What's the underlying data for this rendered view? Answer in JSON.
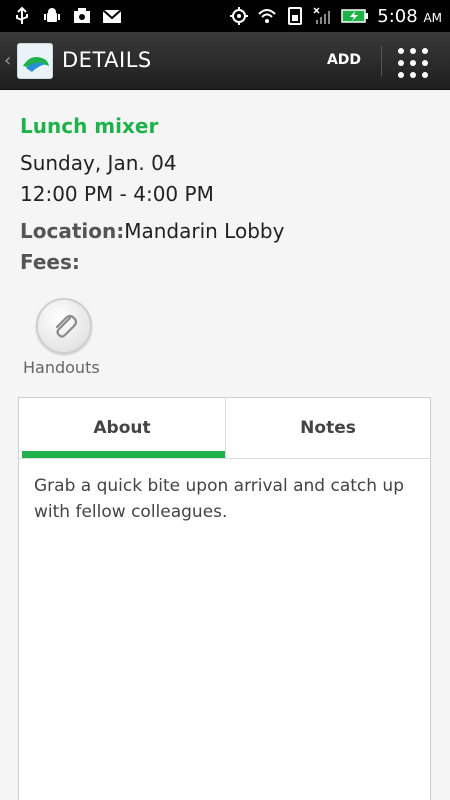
{
  "status_bar": {
    "left_icons": [
      "usb-icon",
      "android-debug-icon",
      "photo-icon",
      "gmail-icon"
    ],
    "right_icons": [
      "gps-icon",
      "wifi-icon",
      "sim-icon",
      "no-signal-icon",
      "battery-charging-icon"
    ],
    "time": "5:08",
    "ampm": "AM"
  },
  "action_bar": {
    "title": "DETAILS",
    "add_label": "ADD",
    "accent": "#1fb24a"
  },
  "event": {
    "title": "Lunch mixer",
    "date": "Sunday, Jan. 04",
    "time_range": "12:00 PM - 4:00 PM",
    "location_label": "Location:",
    "location_value": "Mandarin Lobby",
    "fees_label": "Fees:"
  },
  "handouts": {
    "label": "Handouts",
    "icon": "paperclip-icon"
  },
  "tabs": [
    {
      "label": "About",
      "active": true
    },
    {
      "label": "Notes",
      "active": false
    }
  ],
  "about_text": "Grab a quick bite upon arrival and catch up with fellow colleagues."
}
